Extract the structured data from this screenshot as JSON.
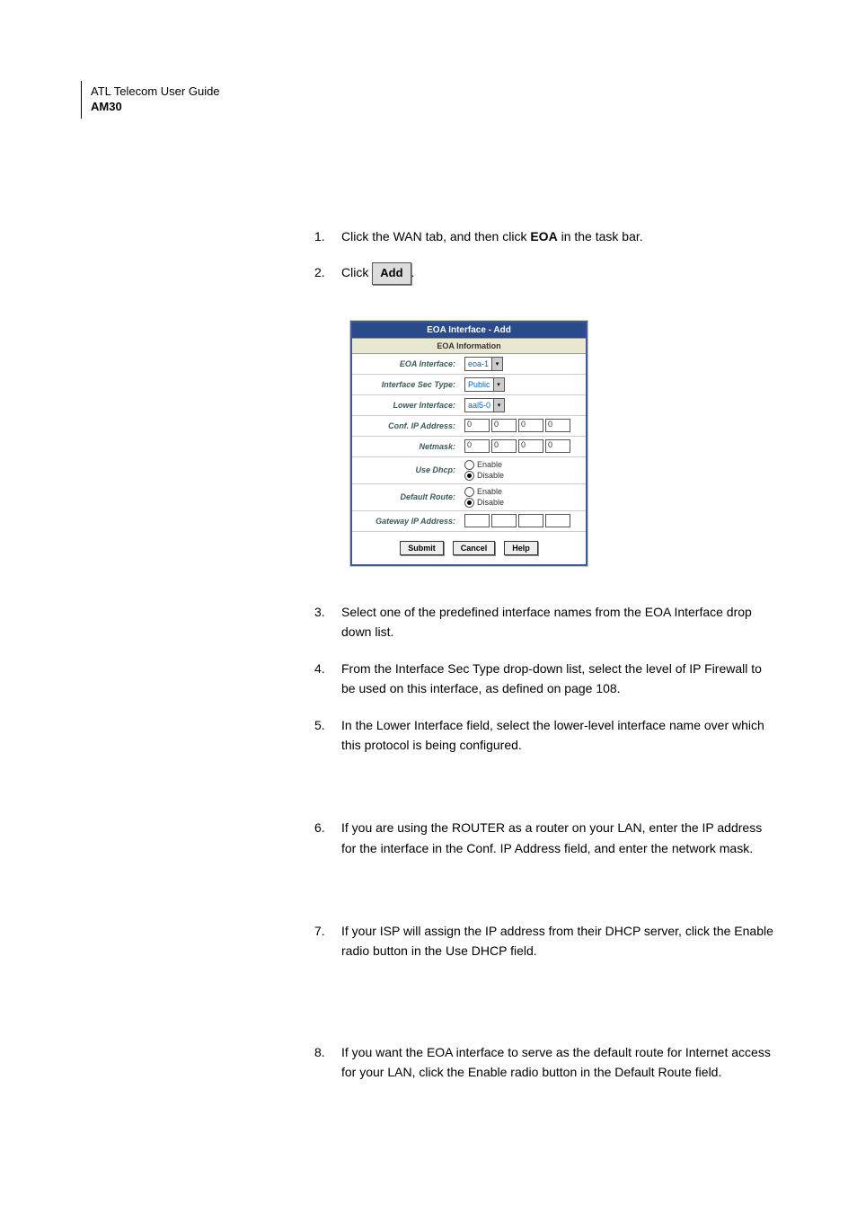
{
  "header": {
    "guide": "ATL Telecom User Guide",
    "model": "AM30"
  },
  "steps": {
    "s1": {
      "num": "1.",
      "pre": "Click the WAN tab, and then click ",
      "bold": "EOA",
      "post": " in the task bar."
    },
    "s2": {
      "num": "2.",
      "pre": "Click ",
      "btn": "Add",
      "post": "."
    },
    "s3": {
      "num": "3.",
      "text": "Select one of the predefined interface names from the EOA Interface drop down list."
    },
    "s4": {
      "num": "4.",
      "text": "From the Interface Sec Type drop-down list, select the level of IP Firewall to be used on this interface, as defined on page 108."
    },
    "s5": {
      "num": "5.",
      "text": "In the Lower Interface field, select the lower-level interface name over which this protocol is being configured."
    },
    "s6": {
      "num": "6.",
      "text": "If you are using the ROUTER as a router on your LAN, enter the IP address for the interface in the Conf. IP Address field, and enter the network mask."
    },
    "s7": {
      "num": "7.",
      "text": "If your ISP will assign the IP address from their DHCP server, click the Enable radio button in the Use DHCP field."
    },
    "s8": {
      "num": "8.",
      "text": "If you want the EOA interface to serve as the default route for Internet access for your LAN, click the Enable radio button in the Default Route field."
    }
  },
  "panel": {
    "title": "EOA Interface - Add",
    "subtitle": "EOA Information",
    "rows": {
      "eoa_if": {
        "label": "EOA Interface:",
        "value": "eoa-1"
      },
      "sec": {
        "label": "Interface Sec Type:",
        "value": "Public"
      },
      "lower": {
        "label": "Lower Interface:",
        "value": "aal5-0"
      },
      "conf": {
        "label": "Conf. IP Address:",
        "v1": "0",
        "v2": "0",
        "v3": "0",
        "v4": "0"
      },
      "mask": {
        "label": "Netmask:",
        "v1": "0",
        "v2": "0",
        "v3": "0",
        "v4": "0"
      },
      "dhcp": {
        "label": "Use Dhcp:",
        "enable": "Enable",
        "disable": "Disable"
      },
      "route": {
        "label": "Default Route:",
        "enable": "Enable",
        "disable": "Disable"
      },
      "gw": {
        "label": "Gateway IP Address:",
        "v1": "",
        "v2": "",
        "v3": "",
        "v4": ""
      }
    },
    "buttons": {
      "submit": "Submit",
      "cancel": "Cancel",
      "help": "Help"
    }
  }
}
